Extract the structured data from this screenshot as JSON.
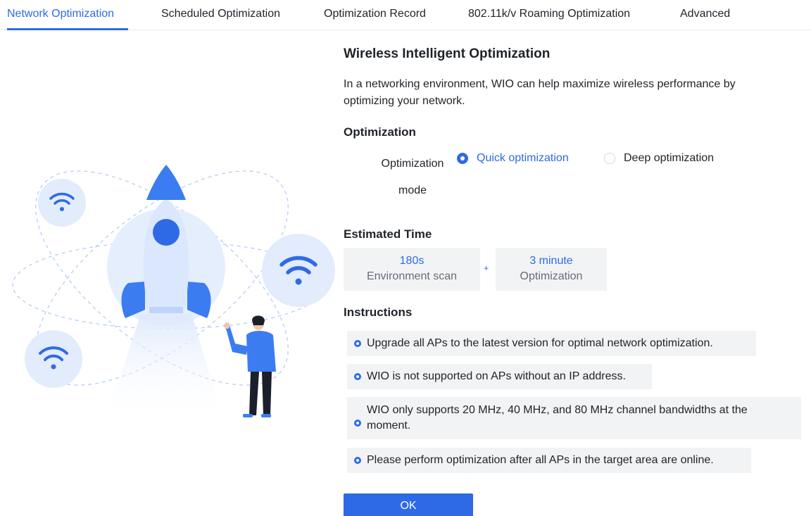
{
  "tabs": [
    {
      "label": "Network Optimization",
      "active": true
    },
    {
      "label": "Scheduled Optimization",
      "active": false
    },
    {
      "label": "Optimization Record",
      "active": false
    },
    {
      "label": "802.11k/v Roaming Optimization",
      "active": false
    },
    {
      "label": "Advanced",
      "active": false
    }
  ],
  "main": {
    "title": "Wireless Intelligent Optimization",
    "description": "In a networking environment, WIO can help maximize wireless performance by optimizing your network.",
    "optimization": {
      "heading": "Optimization",
      "mode_label": "Optimization mode",
      "options": [
        {
          "label": "Quick optimization",
          "selected": true
        },
        {
          "label": "Deep optimization",
          "selected": false
        }
      ]
    },
    "estimated_time": {
      "heading": "Estimated Time",
      "items": [
        {
          "value": "180s",
          "label": "Environment scan"
        },
        {
          "value": "3 minute",
          "label": "Optimization"
        }
      ],
      "separator": "+"
    },
    "instructions": {
      "heading": "Instructions",
      "items": [
        "Upgrade all APs to the latest version for optimal network optimization.",
        "WIO is not supported on APs without an IP address.",
        "WIO only supports 20 MHz, 40 MHz, and 80 MHz channel bandwidths at the moment.",
        "Please perform optimization after all APs in the target area are online."
      ]
    },
    "ok_label": "OK"
  },
  "colors": {
    "accent": "#2f6ae6",
    "panel_bg": "#f2f3f5",
    "text": "#1f2329",
    "muted_text": "#666c75"
  },
  "illustration": {
    "icons": [
      "rocket-icon",
      "wifi-icon",
      "person-icon"
    ]
  }
}
